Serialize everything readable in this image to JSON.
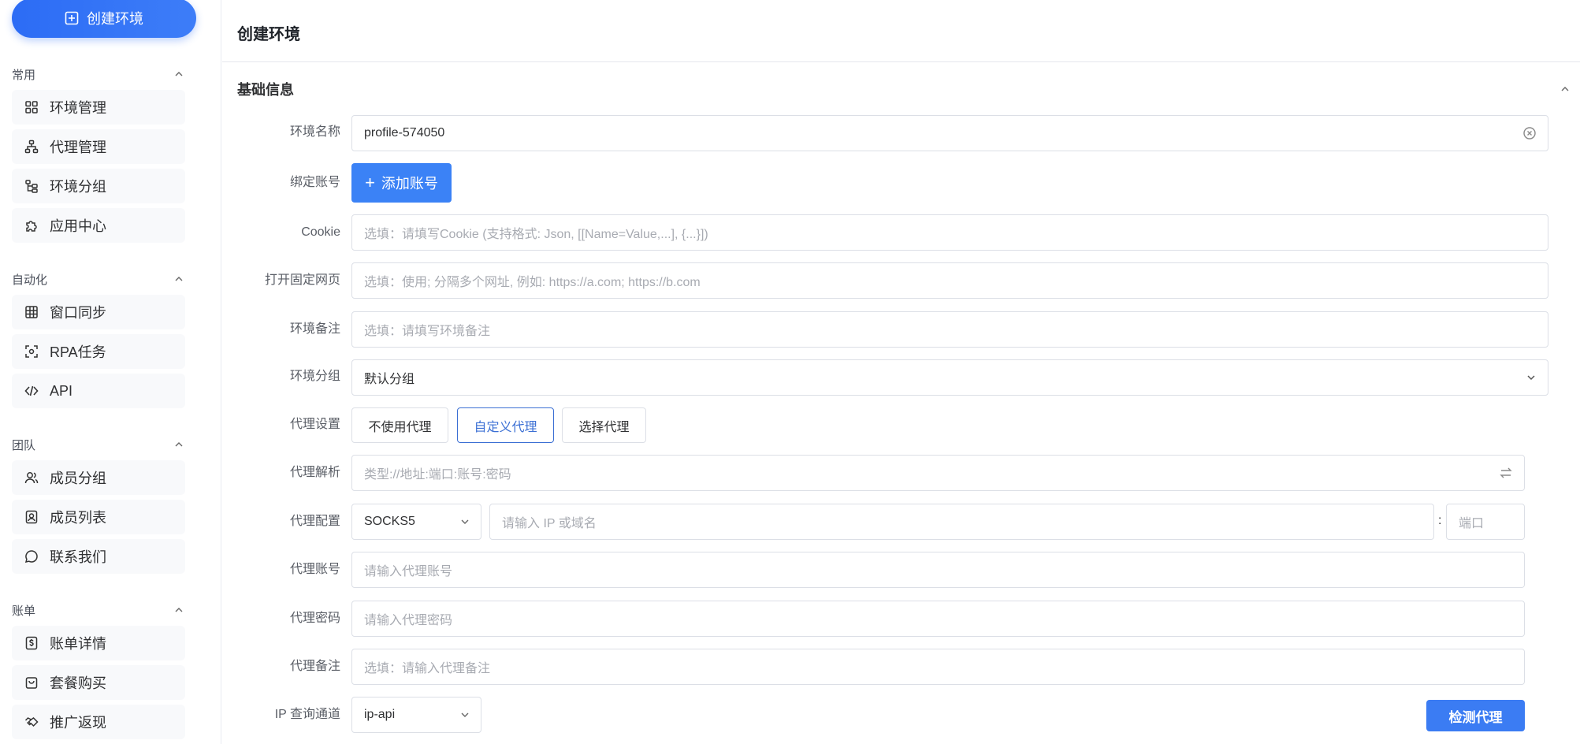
{
  "sidebar": {
    "create_button": "创建环境",
    "sections": [
      {
        "title": "常用",
        "items": [
          "环境管理",
          "代理管理",
          "环境分组",
          "应用中心"
        ]
      },
      {
        "title": "自动化",
        "items": [
          "窗口同步",
          "RPA任务",
          "API"
        ]
      },
      {
        "title": "团队",
        "items": [
          "成员分组",
          "成员列表",
          "联系我们"
        ]
      },
      {
        "title": "账单",
        "items": [
          "账单详情",
          "套餐购买",
          "推广返现"
        ]
      }
    ]
  },
  "main": {
    "page_title": "创建环境",
    "section_title": "基础信息",
    "form": {
      "name_label": "环境名称",
      "name_value": "profile-574050",
      "account_label": "绑定账号",
      "add_account_button": "添加账号",
      "cookie_label": "Cookie",
      "cookie_placeholder": "选填：请填写Cookie (支持格式: Json, [[Name=Value,...], {...}])",
      "fixed_page_label": "打开固定网页",
      "fixed_page_placeholder": "选填：使用; 分隔多个网址, 例如: https://a.com; https://b.com",
      "remark_label": "环境备注",
      "remark_placeholder": "选填：请填写环境备注",
      "group_label": "环境分组",
      "group_value": "默认分组",
      "proxy_setting_label": "代理设置",
      "proxy_options": [
        "不使用代理",
        "自定义代理",
        "选择代理"
      ],
      "proxy_selected": "自定义代理",
      "proxy_parse_label": "代理解析",
      "proxy_parse_placeholder": "类型://地址:端口:账号:密码",
      "proxy_config_label": "代理配置",
      "proxy_type_value": "SOCKS5",
      "proxy_host_placeholder": "请输入 IP 或域名",
      "proxy_colon": ":",
      "proxy_port_placeholder": "端口",
      "proxy_account_label": "代理账号",
      "proxy_account_placeholder": "请输入代理账号",
      "proxy_password_label": "代理密码",
      "proxy_password_placeholder": "请输入代理密码",
      "proxy_remark_label": "代理备注",
      "proxy_remark_placeholder": "选填：请输入代理备注",
      "ip_channel_label": "IP 查询通道",
      "ip_channel_value": "ip-api",
      "detect_button": "检测代理"
    }
  },
  "colors": {
    "accent": "#3b82f6",
    "active_border": "#3b6fd4"
  }
}
